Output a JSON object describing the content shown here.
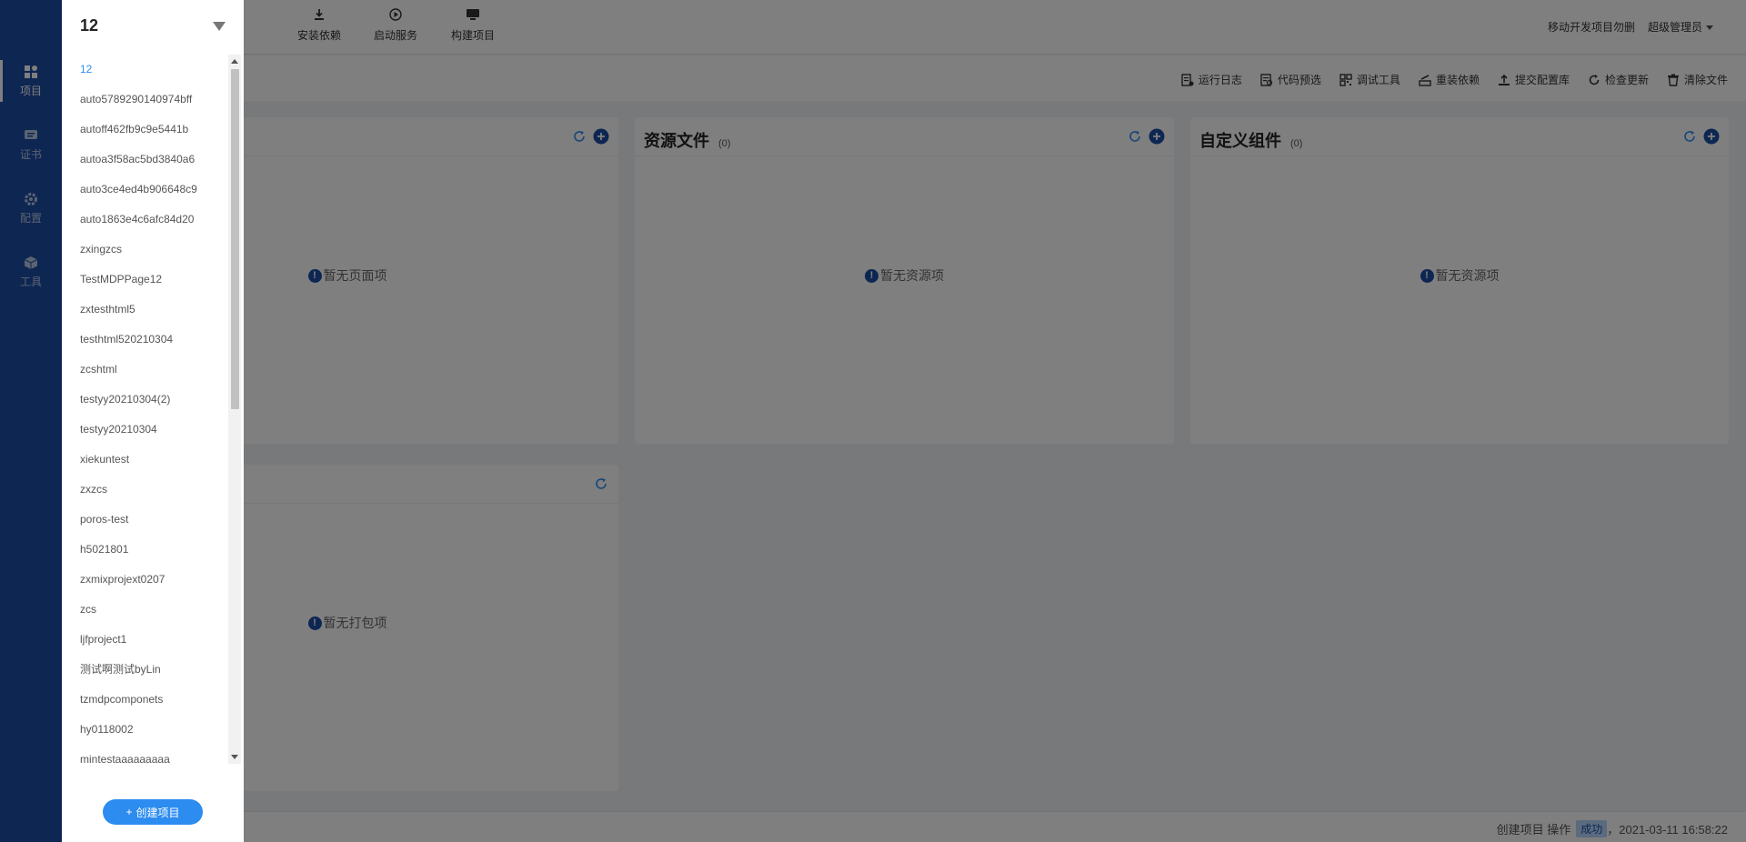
{
  "nav": {
    "items": [
      {
        "label": "项目",
        "icon": "project-icon",
        "active": true
      },
      {
        "label": "证书",
        "icon": "certificate-icon",
        "active": false
      },
      {
        "label": "配置",
        "icon": "gear-icon",
        "active": false
      },
      {
        "label": "工具",
        "icon": "cube-icon",
        "active": false
      }
    ]
  },
  "header": {
    "tools": [
      {
        "label": "安装依赖",
        "icon": "download-icon"
      },
      {
        "label": "启动服务",
        "icon": "play-circle-icon"
      },
      {
        "label": "构建项目",
        "icon": "monitor-icon"
      }
    ],
    "notice": "移动开发项目勿删",
    "user": "超级管理员"
  },
  "toolbar": {
    "actions": [
      {
        "label": "运行日志",
        "icon": "log-icon"
      },
      {
        "label": "代码预选",
        "icon": "code-preview-icon"
      },
      {
        "label": "调试工具",
        "icon": "qrcode-icon"
      },
      {
        "label": "重装依赖",
        "icon": "reinstall-icon"
      },
      {
        "label": "提交配置库",
        "icon": "upload-icon"
      },
      {
        "label": "检查更新",
        "icon": "refresh-icon"
      },
      {
        "label": "清除文件",
        "icon": "trash-icon"
      }
    ]
  },
  "cards": {
    "pages": {
      "empty": "暂无页面项"
    },
    "resources": {
      "title": "资源文件",
      "count": "(0)",
      "empty": "暂无资源项"
    },
    "components": {
      "title": "自定义组件",
      "count": "(0)",
      "empty": "暂无资源项"
    },
    "packages": {
      "empty": "暂无打包项"
    }
  },
  "status": {
    "text": "创建项目 操作",
    "badge": "成功",
    "timestamp": "，2021-03-11 16:58:22"
  },
  "drawer": {
    "current": "12",
    "projects": [
      "12",
      "auto5789290140974bff",
      "autoff462fb9c9e5441b",
      "autoa3f58ac5bd3840a6",
      "auto3ce4ed4b906648c9",
      "auto1863e4c6afc84d20",
      "zxingzcs",
      "TestMDPPage12",
      "zxtesthtml5",
      "testhtml520210304",
      "zcshtml",
      "testyy20210304(2)",
      "testyy20210304",
      "xiekuntest",
      "zxzcs",
      "poros-test",
      "h5021801",
      "zxmixprojext0207",
      "zcs",
      "ljfproject1",
      "测试啊测试byLin",
      "tzmdpcomponets",
      "hy0118002",
      "mintestaaaaaaaaa"
    ],
    "create_label": "创建项目"
  },
  "colors": {
    "brand": "#1d4da5",
    "accent": "#2d8cf0"
  }
}
